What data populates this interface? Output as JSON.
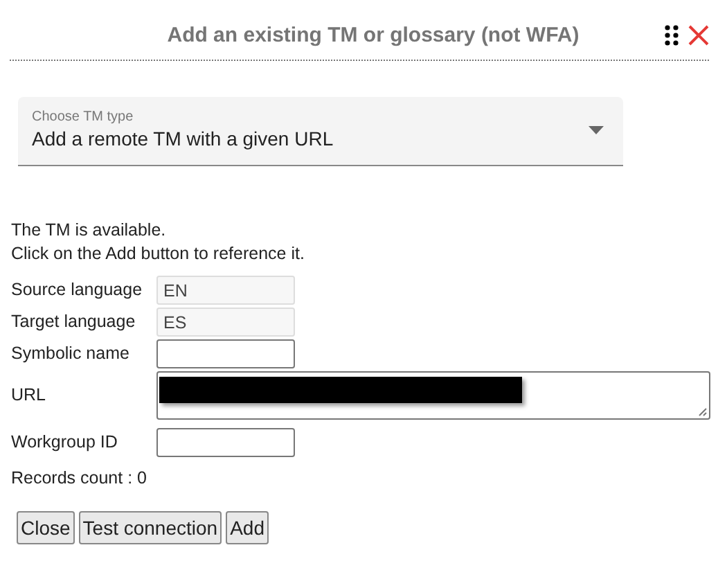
{
  "dialog": {
    "title": "Add an existing TM or glossary (not WFA)"
  },
  "tm_type": {
    "label": "Choose TM type",
    "value": "Add a remote TM with a given URL"
  },
  "messages": [
    "The TM is available.",
    "Click on the Add button to reference it."
  ],
  "fields": [
    {
      "label": "Source language",
      "kind": "readonly",
      "value": "EN"
    },
    {
      "label": "Target language",
      "kind": "readonly",
      "value": "ES"
    },
    {
      "label": "Symbolic name",
      "kind": "text"
    },
    {
      "label": "URL",
      "kind": "textarea",
      "redacted": true
    },
    {
      "label": "Workgroup ID",
      "kind": "text"
    }
  ],
  "records_count": "Records count : 0",
  "buttons": [
    "Close",
    "Test connection",
    "Add"
  ]
}
